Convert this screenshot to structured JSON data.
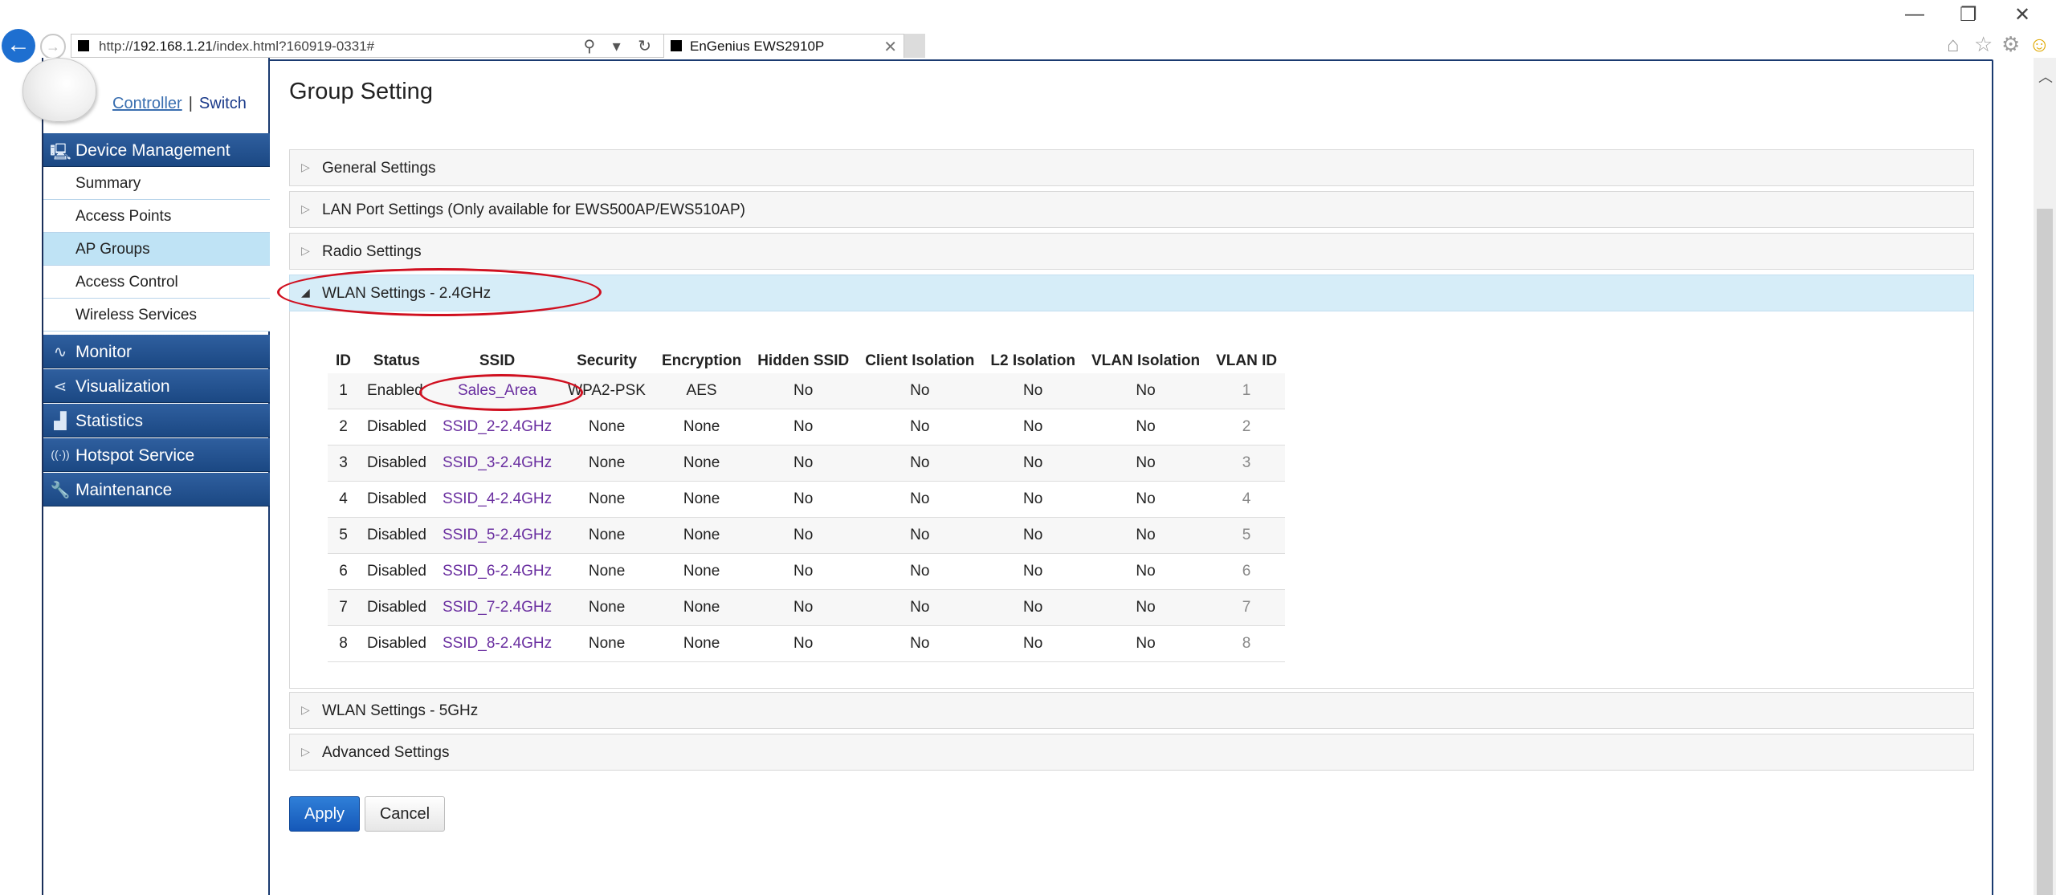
{
  "browser": {
    "url_prefix": "http://",
    "url_host": "192.168.1.21",
    "url_rest": "/index.html?160919-0331#",
    "address_tools": "⚲ ▾ ↻",
    "tab_title": "EnGenius EWS2910P",
    "tab_close": "✕",
    "back_icon": "←",
    "forward_icon": "→"
  },
  "window_controls": {
    "minimize": "—",
    "restore": "❐",
    "close": "✕"
  },
  "right_tools": {
    "home": "⌂",
    "favorites": "☆",
    "settings": "⚙",
    "feedback": "☺"
  },
  "modes": {
    "controller": "Controller",
    "separator": "|",
    "switch": "Switch"
  },
  "sidebar": {
    "device_management": {
      "label": "Device Management",
      "icon": "🖳"
    },
    "items": [
      {
        "label": "Summary"
      },
      {
        "label": "Access Points"
      },
      {
        "label": "AP Groups",
        "active": true
      },
      {
        "label": "Access Control"
      },
      {
        "label": "Wireless Services"
      }
    ],
    "heads": [
      {
        "label": "Monitor",
        "icon": "∿"
      },
      {
        "label": "Visualization",
        "icon": "⋖"
      },
      {
        "label": "Statistics",
        "icon": "▟"
      },
      {
        "label": "Hotspot Service",
        "icon": "((·))"
      },
      {
        "label": "Maintenance",
        "icon": "🔧"
      }
    ]
  },
  "main": {
    "title": "Group Setting",
    "sections": [
      {
        "label": "General Settings",
        "icon": "▷"
      },
      {
        "label": "LAN Port Settings (Only available for EWS500AP/EWS510AP)",
        "icon": "▷"
      },
      {
        "label": "Radio Settings",
        "icon": "▷"
      },
      {
        "label": "WLAN Settings - 2.4GHz",
        "icon": "◢",
        "open": true
      },
      {
        "label": "WLAN Settings - 5GHz",
        "icon": "▷"
      },
      {
        "label": "Advanced Settings",
        "icon": "▷"
      }
    ],
    "table": {
      "headers": [
        "ID",
        "Status",
        "SSID",
        "Security",
        "Encryption",
        "Hidden SSID",
        "Client Isolation",
        "L2 Isolation",
        "VLAN Isolation",
        "VLAN ID"
      ],
      "rows": [
        [
          "1",
          "Enabled",
          "Sales_Area",
          "WPA2-PSK",
          "AES",
          "No",
          "No",
          "No",
          "No",
          "1"
        ],
        [
          "2",
          "Disabled",
          "SSID_2-2.4GHz",
          "None",
          "None",
          "No",
          "No",
          "No",
          "No",
          "2"
        ],
        [
          "3",
          "Disabled",
          "SSID_3-2.4GHz",
          "None",
          "None",
          "No",
          "No",
          "No",
          "No",
          "3"
        ],
        [
          "4",
          "Disabled",
          "SSID_4-2.4GHz",
          "None",
          "None",
          "No",
          "No",
          "No",
          "No",
          "4"
        ],
        [
          "5",
          "Disabled",
          "SSID_5-2.4GHz",
          "None",
          "None",
          "No",
          "No",
          "No",
          "No",
          "5"
        ],
        [
          "6",
          "Disabled",
          "SSID_6-2.4GHz",
          "None",
          "None",
          "No",
          "No",
          "No",
          "No",
          "6"
        ],
        [
          "7",
          "Disabled",
          "SSID_7-2.4GHz",
          "None",
          "None",
          "No",
          "No",
          "No",
          "No",
          "7"
        ],
        [
          "8",
          "Disabled",
          "SSID_8-2.4GHz",
          "None",
          "None",
          "No",
          "No",
          "No",
          "No",
          "8"
        ]
      ]
    },
    "buttons": {
      "apply": "Apply",
      "cancel": "Cancel"
    }
  },
  "colors": {
    "accent": "#1b4883",
    "active_item": "#bfe3f5",
    "open_section": "#d6edf8",
    "annotation": "#d01020",
    "ssid_link": "#6a2fa0"
  }
}
